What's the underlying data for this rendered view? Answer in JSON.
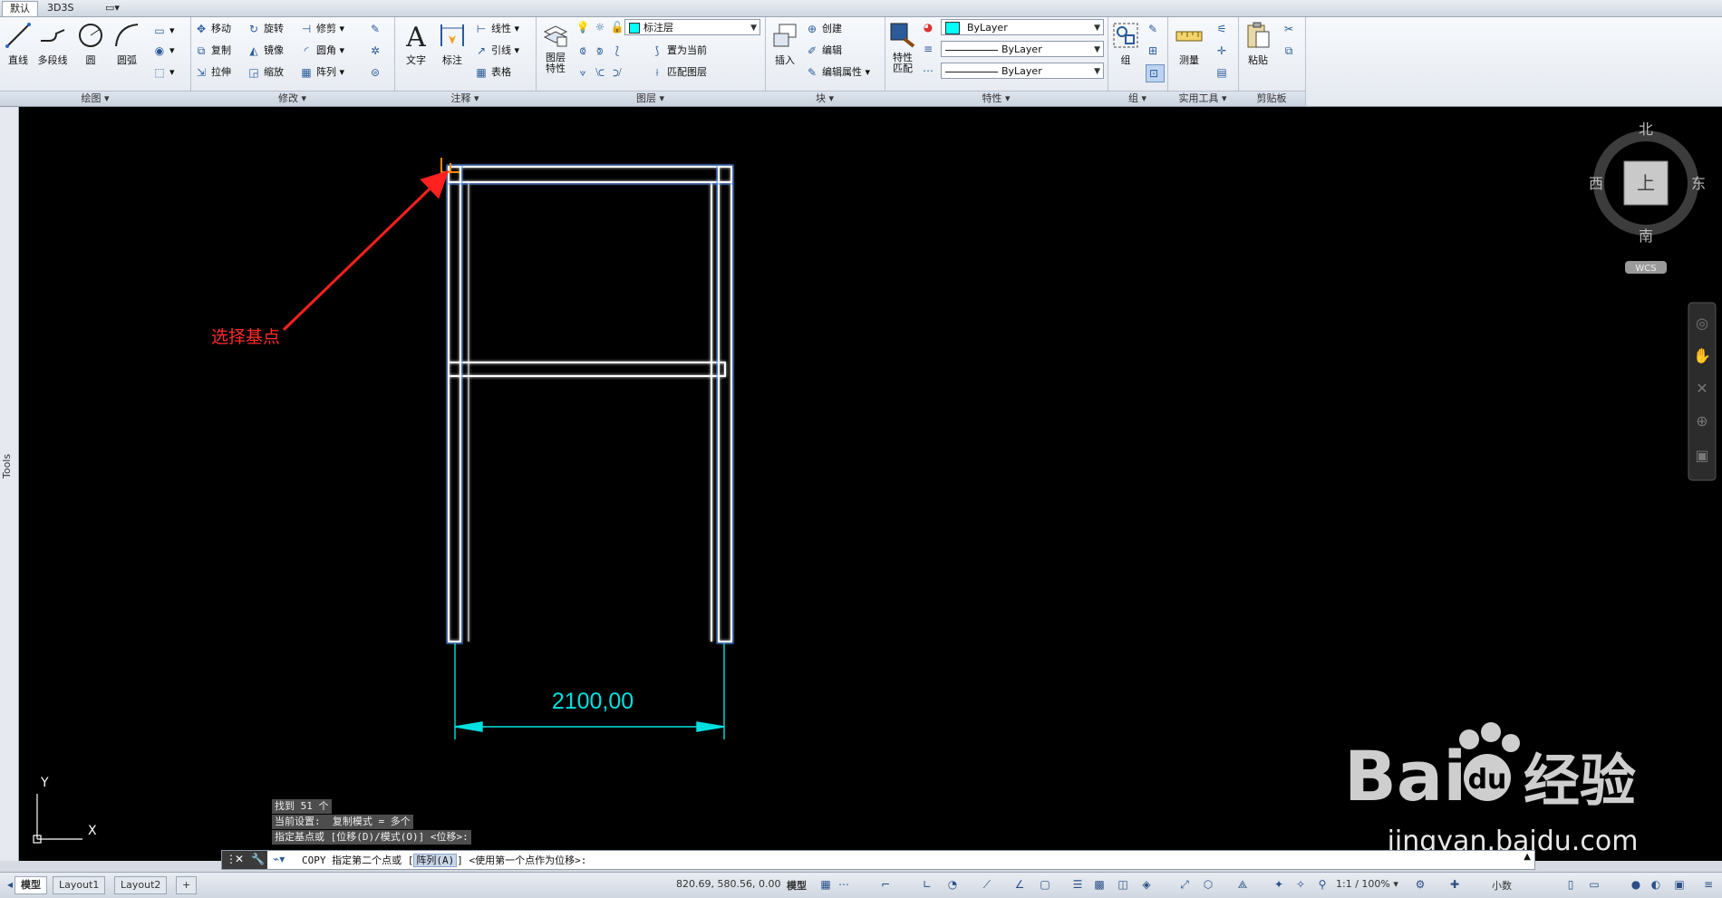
{
  "tabs": [
    "默认",
    "3D3S"
  ],
  "ribbon": {
    "draw": {
      "title": "绘图 ▾",
      "line": "直线",
      "pline": "多段线",
      "circle": "圆",
      "arc": "圆弧"
    },
    "modify": {
      "title": "修改 ▾",
      "move": "移动",
      "rotate": "旋转",
      "trim": "修剪",
      "copy": "复制",
      "mirror": "镜像",
      "fillet": "圆角",
      "stretch": "拉伸",
      "scale": "缩放",
      "array": "阵列"
    },
    "annotate": {
      "title": "注释 ▾",
      "text": "文字",
      "dim": "标注",
      "linear": "线性",
      "leader": "引线",
      "table": "表格"
    },
    "layers": {
      "title": "图层 ▾",
      "props": "图层\n特性",
      "current_layer": "标注层",
      "set_current": "置为当前",
      "match_layer": "匹配图层"
    },
    "block": {
      "title": "块 ▾",
      "insert": "插入",
      "create": "创建",
      "edit": "编辑",
      "edit_attr": "编辑属性"
    },
    "properties": {
      "title": "特性 ▾",
      "match": "特性\n匹配",
      "color": "ByLayer",
      "lineweight": "ByLayer",
      "linetype": "ByLayer",
      "accent": "#00ffff"
    },
    "group": {
      "title": "组 ▾",
      "group": "组"
    },
    "utilities": {
      "title": "实用工具 ▾",
      "measure": "测量"
    },
    "clipboard": {
      "title": "剪贴板",
      "paste": "粘贴"
    }
  },
  "side_palette": {
    "label": "Tools"
  },
  "drawing": {
    "annotation": "选择基点",
    "dimension": "2100,00",
    "ucs_y": "Y",
    "ucs_x": "X",
    "viewcube": {
      "north": "北",
      "south": "南",
      "east": "东",
      "west": "西",
      "top": "上",
      "wcs": "WCS"
    }
  },
  "command_history": [
    "找到 51 个",
    "当前设置:  复制模式 = 多个",
    "指定基点或 [位移(D)/模式(O)] <位移>:"
  ],
  "command_line": {
    "prefix": "COPY 指定第二个点或 [",
    "option": "阵列(A)",
    "suffix": "] <使用第一个点作为位移>:"
  },
  "status": {
    "layout_tabs": [
      "模型",
      "Layout1",
      "Layout2",
      "+"
    ],
    "coords": "820.69, 580.56, 0.00",
    "model": "模型",
    "scale": "1:1 / 100% ▾",
    "units": "小数"
  },
  "watermark": {
    "brand": "Baidu经验",
    "url": "jingyan.baidu.com"
  }
}
